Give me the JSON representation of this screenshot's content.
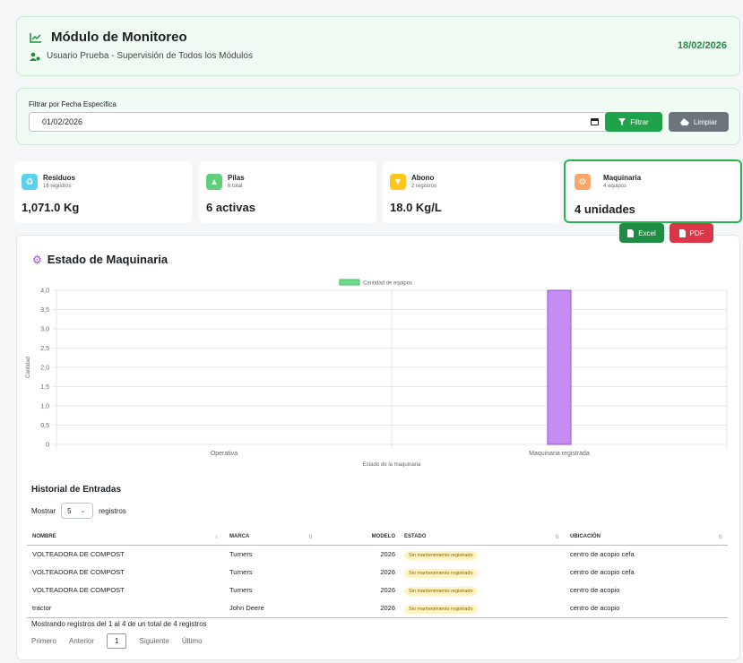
{
  "header": {
    "title": "Módulo de Monitoreo",
    "subtitle": "Usuario Prueba - Supervisión de Todos los Módulos",
    "date": "18/02/2026"
  },
  "filter": {
    "label": "Filtrar por Fecha Específica",
    "date_value": "01/02/2026",
    "filter_label": "Filtrar",
    "clear_label": "Limpiar"
  },
  "stats": [
    {
      "name": "Residuos",
      "count": "16 registros",
      "value": "1,071.0 Kg",
      "color": "#5bd0f0"
    },
    {
      "name": "Pilas",
      "count": "6 total",
      "value": "6 activas",
      "color": "#5fd17a"
    },
    {
      "name": "Abono",
      "count": "2 registros",
      "value": "18.0 Kg/L",
      "color": "#ffc61a"
    },
    {
      "name": "Maquinaria",
      "count": "4 equipos",
      "value": "4 unidades",
      "color": "#fba566"
    }
  ],
  "panel": {
    "title": "Estado de Maquinaria",
    "excel_label": "Excel",
    "pdf_label": "PDF"
  },
  "chart_data": {
    "type": "bar",
    "categories": [
      "Operativa",
      "Maquinaria registrada"
    ],
    "series": [
      {
        "name": "Cantidad de equipos",
        "values": [
          0,
          4
        ],
        "color": "#c58cf2"
      }
    ],
    "xlabel": "Estado de la maquinaria",
    "ylabel": "Cantidad",
    "ylim": [
      0,
      4
    ],
    "yticks": [
      "4,0",
      "3,5",
      "3,0",
      "2,5",
      "2,0",
      "1,5",
      "1,0",
      "0,5",
      "0"
    ],
    "grid": true,
    "legend": "top-center"
  },
  "history": {
    "title": "Historial de Entradas",
    "show_prefix": "Mostrar",
    "show_value": "5",
    "show_suffix": "registros",
    "columns": [
      "NOMBRE",
      "MARCA",
      "MODELO",
      "ESTADO",
      "UBICACIÓN"
    ],
    "rows": [
      {
        "nombre": "VOLTEADORA DE COMPOST",
        "marca": "Turners",
        "modelo": "2026",
        "estado": "Sin mantenimiento registrado",
        "ubicacion": "centro de acopio cefa"
      },
      {
        "nombre": "VOLTEADORA DE COMPOST",
        "marca": "Turners",
        "modelo": "2026",
        "estado": "Sin mantenimiento registrado",
        "ubicacion": "centro de acopio cefa"
      },
      {
        "nombre": "VOLTEADORA DE COMPOST",
        "marca": "Turners",
        "modelo": "2026",
        "estado": "Sin mantenimiento registrado",
        "ubicacion": "centro de acopio"
      },
      {
        "nombre": "tractor",
        "marca": "John Deere",
        "modelo": "2026",
        "estado": "Sin mantenimiento registrado",
        "ubicacion": "centro de acopio"
      }
    ],
    "info": "Mostrando registros del 1 al 4 de un total de 4 registros",
    "pager": {
      "first": "Primero",
      "prev": "Anterior",
      "current": "1",
      "next": "Siguiente",
      "last": "Último"
    }
  }
}
